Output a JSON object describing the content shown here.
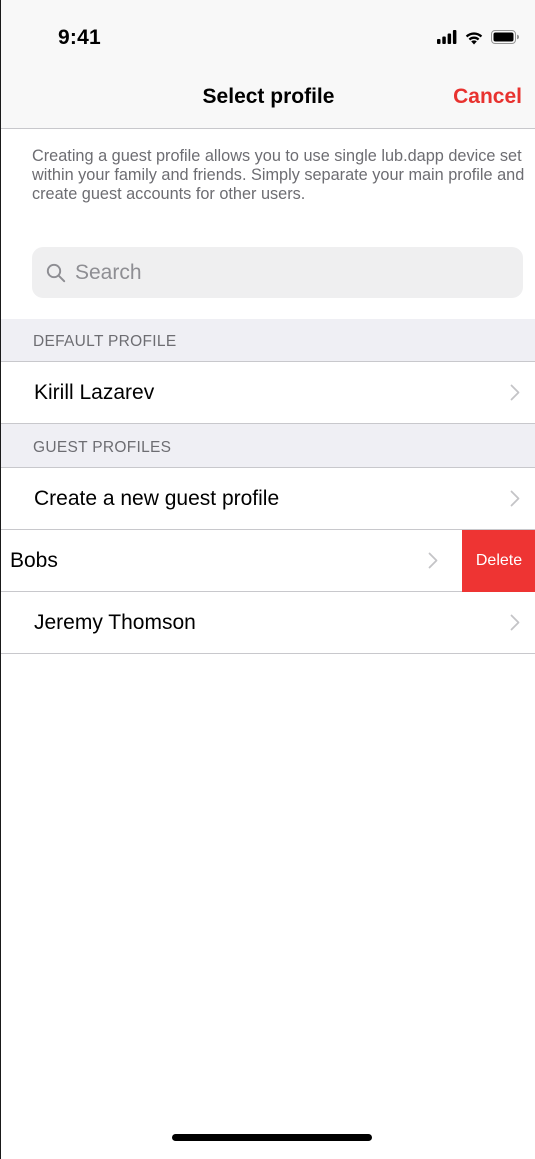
{
  "status_bar": {
    "time": "9:41",
    "icons": [
      "signal-icon",
      "wifi-icon",
      "battery-icon"
    ]
  },
  "nav": {
    "title": "Select profile",
    "cancel_label": "Cancel"
  },
  "description": "Creating a guest profile allows you to use single lub.dapp device set within your family and friends. Simply separate your main profile and create guest accounts for other users.",
  "search": {
    "placeholder": "Search",
    "icon": "search-icon"
  },
  "sections": {
    "default": {
      "header": "DEFAULT PROFILE",
      "items": [
        "Kirill Lazarev"
      ]
    },
    "guest": {
      "header": "GUEST PROFILES",
      "create_label": "Create a new guest profile",
      "items": [
        "Bobs",
        "Jeremy Thomson"
      ],
      "delete_label": "Delete"
    }
  },
  "colors": {
    "accent": "#e8322f",
    "delete": "#ee3433",
    "secondary_text": "#6d6d72",
    "separator": "#c8c8cc",
    "section_background": "#efeff4"
  }
}
